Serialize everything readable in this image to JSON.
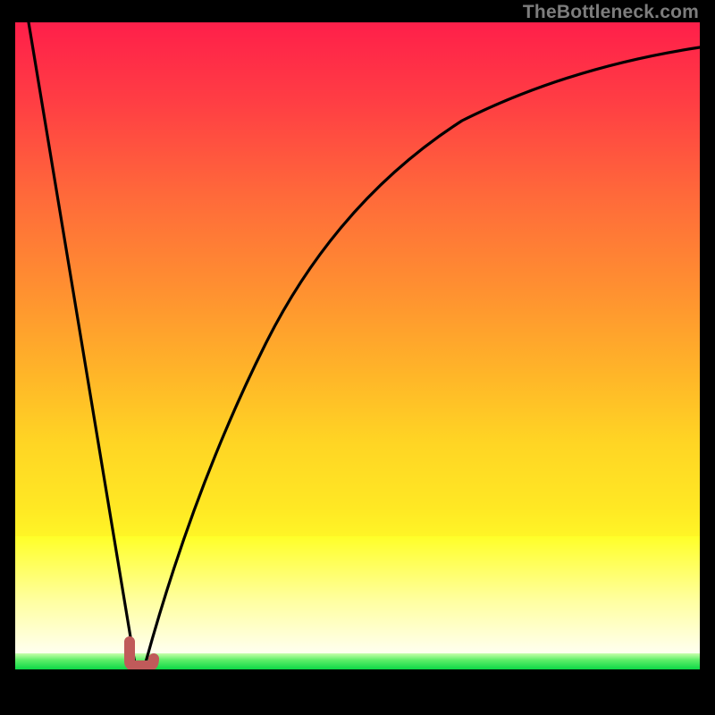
{
  "credit": "TheBottleneck.com",
  "colors": {
    "frame": "#000000",
    "curve": "#000000",
    "marker": "#c05a5a",
    "gradient_top": "#ff1f4a",
    "gradient_mid": "#ffd524",
    "gradient_low": "#ffff28",
    "green_band": "#00e85a"
  },
  "chart_data": {
    "type": "line",
    "title": "",
    "xlabel": "",
    "ylabel": "",
    "xlim": [
      0,
      100
    ],
    "ylim": [
      0,
      100
    ],
    "description": "Two black curves on a vertical red-to-yellow-to-green gradient. Left curve descends steeply from the top-left corner to a minimum near x≈17, y≈0; right curve rises logarithmically from the same minimum toward the top-right, approaching y≈96 at x=100. A short red L-shaped marker sits at the minimum.",
    "series": [
      {
        "name": "left-descending",
        "x": [
          2,
          4,
          6,
          8,
          10,
          12,
          14,
          16,
          17.5
        ],
        "values": [
          100,
          88,
          75,
          62,
          50,
          37,
          25,
          10,
          0
        ]
      },
      {
        "name": "right-ascending",
        "x": [
          19,
          22,
          26,
          30,
          35,
          40,
          46,
          52,
          58,
          65,
          72,
          80,
          90,
          100
        ],
        "values": [
          2,
          12,
          25,
          36,
          47,
          56,
          64,
          70,
          75,
          80,
          84,
          88,
          92,
          96
        ]
      }
    ],
    "marker": {
      "x": 17.2,
      "y": 1.0,
      "shape": "L",
      "color": "#c05a5a"
    },
    "bands": [
      {
        "name": "red-orange-yellow-gradient",
        "y_from": 17,
        "y_to": 100
      },
      {
        "name": "pale-yellow-glow",
        "y_from": 4.5,
        "y_to": 17
      },
      {
        "name": "green-strip",
        "y_from": 0,
        "y_to": 4.5
      }
    ]
  }
}
